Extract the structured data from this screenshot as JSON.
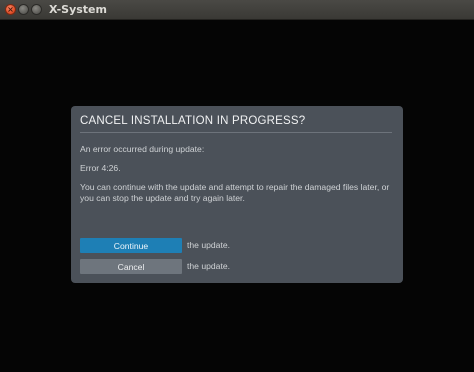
{
  "window": {
    "title": "X-System",
    "close_glyph": "×",
    "minimize_glyph": "",
    "maximize_glyph": ""
  },
  "dialog": {
    "title": "CANCEL INSTALLATION IN PROGRESS?",
    "message_line1": "An error occurred during update:",
    "message_line2": "Error 4:26.",
    "message_line3": "You can continue with the update and attempt to repair the damaged files later, or you can stop the update and try again later.",
    "continue_label": "Continue",
    "continue_desc": "the update.",
    "cancel_label": "Cancel",
    "cancel_desc": "the update."
  },
  "colors": {
    "dialog_bg": "#4b5159",
    "continue_button": "#1e7fb5",
    "cancel_button": "#6e757d",
    "close_button": "#e4512a"
  },
  "icons": {
    "close": "close-icon",
    "minimize": "minimize-icon",
    "maximize": "maximize-icon"
  }
}
